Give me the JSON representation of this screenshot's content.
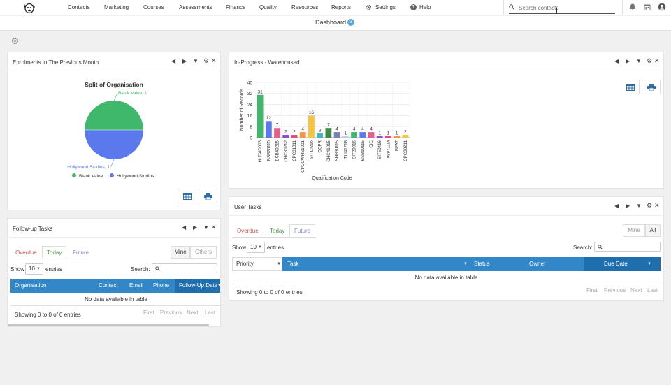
{
  "nav": {
    "items": [
      "Contacts",
      "Marketing",
      "Courses",
      "Assessments",
      "Finance",
      "Quality",
      "Resources",
      "Reports",
      "Settings",
      "Help"
    ],
    "search_placeholder": "Search contacts"
  },
  "header": {
    "title": "Dashboard"
  },
  "panels": {
    "enrolments": {
      "title": "Enrolments In The Previous Month",
      "chart": {
        "type": "pie",
        "title": "Split of Organisation",
        "slices": [
          {
            "name": "Blank Value",
            "value": 1,
            "color": "#3fb86b",
            "label": "Blank Value, 1"
          },
          {
            "name": "Hollywood Studios",
            "value": 1,
            "color": "#5b78ec",
            "label": "Hollywood Studios, 1"
          }
        ],
        "legend": [
          "Blank Value",
          "Hollywood Studios"
        ]
      }
    },
    "inprogress": {
      "title": "In-Progress - Warehoused"
    },
    "followup": {
      "title": "Follow-up Tasks",
      "tabs": [
        "Overdue",
        "Today",
        "Future"
      ],
      "toggle": [
        "Mine",
        "Others"
      ],
      "show_label": "Show",
      "show_value": "10",
      "entries_label": "entries",
      "search_label": "Search:",
      "columns": [
        "Organisation",
        "Contact",
        "Email",
        "Phone",
        "Follow-Up Date"
      ],
      "empty": "No data available in table",
      "info": "Showing 0 to 0 of 0 entries",
      "pager": [
        "First",
        "Previous",
        "Next",
        "Last"
      ]
    },
    "usertasks": {
      "title": "User Tasks",
      "tabs": [
        "Overdue",
        "Today",
        "Future"
      ],
      "toggle": [
        "Mine",
        "All"
      ],
      "show_label": "Show",
      "show_value": "10",
      "entries_label": "entries",
      "search_label": "Search:",
      "columns": [
        "Priority",
        "Task",
        "Status",
        "Owner",
        "Due Date"
      ],
      "empty": "No data available in table",
      "info": "Showing 0 to 0 of 0 entries",
      "pager": [
        "First",
        "Previous",
        "Next",
        "Last"
      ]
    }
  },
  "chart_data": {
    "type": "bar",
    "title": "",
    "xlabel": "Qualification Code",
    "ylabel": "Number of Records",
    "ylim": [
      0,
      40
    ],
    "yticks": [
      0,
      8,
      16,
      24,
      32,
      40
    ],
    "grid": true,
    "categories": [
      "HLTAID003",
      "BSB20115",
      "BSB40215",
      "CHC30212",
      "CPC31311",
      "CPCCWHS1001",
      "SIT10216",
      "CCPR",
      "CHC41015",
      "SHB30115",
      "TLI41218",
      "SIT20316",
      "BSB10115",
      "CIC",
      "SIT50416",
      "089711M",
      "BFAT",
      "CPC30211"
    ],
    "values": [
      31,
      12,
      7,
      2,
      2,
      4,
      16,
      3,
      7,
      4,
      1,
      4,
      4,
      4,
      1,
      1,
      1,
      2
    ],
    "colors": [
      "#3fb86b",
      "#5b78ec",
      "#e65e8a",
      "#8a4fc6",
      "#e6467a",
      "#f4934a",
      "#f6c342",
      "#43b2c4",
      "#3d8c47",
      "#7b7fb4",
      "#b9d3ea",
      "#3fb86b",
      "#5b78ec",
      "#e65e8a",
      "#8a4fc6",
      "#e6467a",
      "#f4934a",
      "#f6c342"
    ]
  }
}
